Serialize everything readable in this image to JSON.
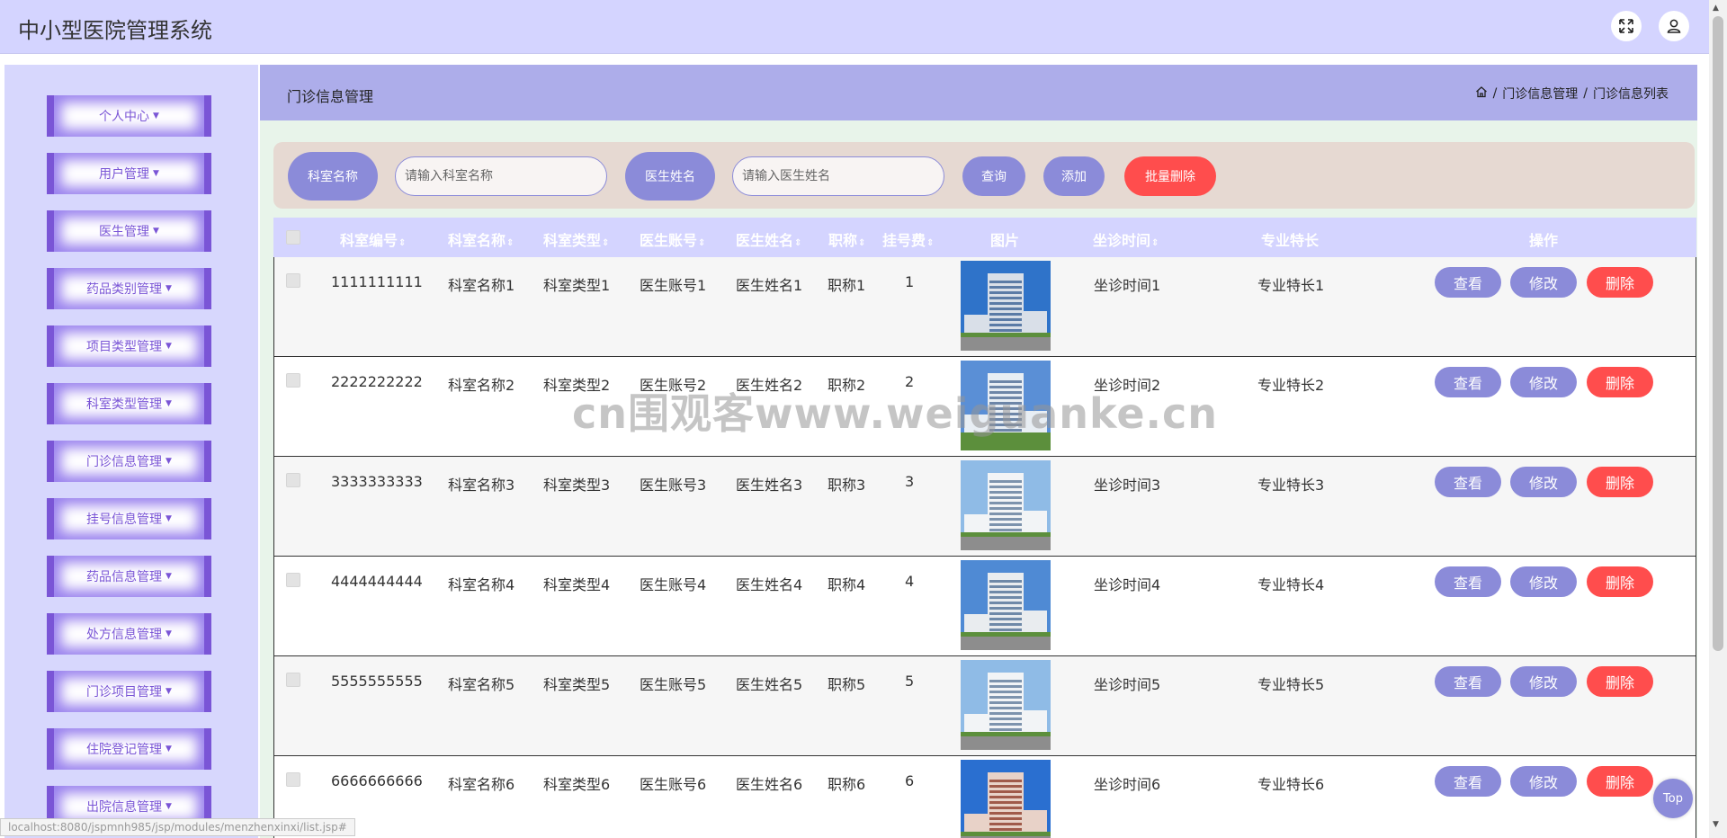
{
  "app": {
    "title": "中小型医院管理系统"
  },
  "topbar": {
    "fullscreen_icon": "fullscreen-icon",
    "user_icon": "user-icon"
  },
  "sidebar": {
    "items": [
      {
        "label": "个人中心"
      },
      {
        "label": "用户管理"
      },
      {
        "label": "医生管理"
      },
      {
        "label": "药品类别管理"
      },
      {
        "label": "项目类型管理"
      },
      {
        "label": "科室类型管理"
      },
      {
        "label": "门诊信息管理"
      },
      {
        "label": "挂号信息管理"
      },
      {
        "label": "药品信息管理"
      },
      {
        "label": "处方信息管理"
      },
      {
        "label": "门诊项目管理"
      },
      {
        "label": "住院登记管理"
      },
      {
        "label": "出院信息管理"
      }
    ]
  },
  "header": {
    "page_title": "门诊信息管理",
    "breadcrumb": [
      "门诊信息管理",
      "门诊信息列表"
    ],
    "separator": "/"
  },
  "search": {
    "dept_label": "科室名称",
    "dept_placeholder": "请输入科室名称",
    "doctor_label": "医生姓名",
    "doctor_placeholder": "请输入医生姓名",
    "query_btn": "查询",
    "add_btn": "添加",
    "batch_delete_btn": "批量删除"
  },
  "table": {
    "columns": [
      "科室编号",
      "科室名称",
      "科室类型",
      "医生账号",
      "医生姓名",
      "职称",
      "挂号费",
      "图片",
      "坐诊时间",
      "专业特长",
      "操作"
    ],
    "sort_glyph": "⇕",
    "rows": [
      {
        "code": "1111111111",
        "dept": "科室名称1",
        "type": "科室类型1",
        "account": "医生账号1",
        "name": "医生姓名1",
        "title": "职称1",
        "fee": "1",
        "time": "坐诊时间1",
        "spec": "专业特长1"
      },
      {
        "code": "2222222222",
        "dept": "科室名称2",
        "type": "科室类型2",
        "account": "医生账号2",
        "name": "医生姓名2",
        "title": "职称2",
        "fee": "2",
        "time": "坐诊时间2",
        "spec": "专业特长2"
      },
      {
        "code": "3333333333",
        "dept": "科室名称3",
        "type": "科室类型3",
        "account": "医生账号3",
        "name": "医生姓名3",
        "title": "职称3",
        "fee": "3",
        "time": "坐诊时间3",
        "spec": "专业特长3"
      },
      {
        "code": "4444444444",
        "dept": "科室名称4",
        "type": "科室类型4",
        "account": "医生账号4",
        "name": "医生姓名4",
        "title": "职称4",
        "fee": "4",
        "time": "坐诊时间4",
        "spec": "专业特长4"
      },
      {
        "code": "5555555555",
        "dept": "科室名称5",
        "type": "科室类型5",
        "account": "医生账号5",
        "name": "医生姓名5",
        "title": "职称5",
        "fee": "5",
        "time": "坐诊时间5",
        "spec": "专业特长5"
      },
      {
        "code": "6666666666",
        "dept": "科室名称6",
        "type": "科室类型6",
        "account": "医生账号6",
        "name": "医生姓名6",
        "title": "职称6",
        "fee": "6",
        "time": "坐诊时间6",
        "spec": "专业特长6"
      }
    ],
    "actions": {
      "view": "查看",
      "edit": "修改",
      "delete": "删除"
    }
  },
  "watermark": "cn围观客www.weiguanke.cn",
  "status_url": "localhost:8080/jspmnh985/jsp/modules/menzhenxinxi/list.jsp#",
  "back_to_top": "Top",
  "colors": {
    "accent": "#8b8bd9",
    "danger": "#ff4d4d",
    "topbar": "#d4d4ff",
    "sidebar": "#d7d7fd",
    "header": "#adadea"
  }
}
